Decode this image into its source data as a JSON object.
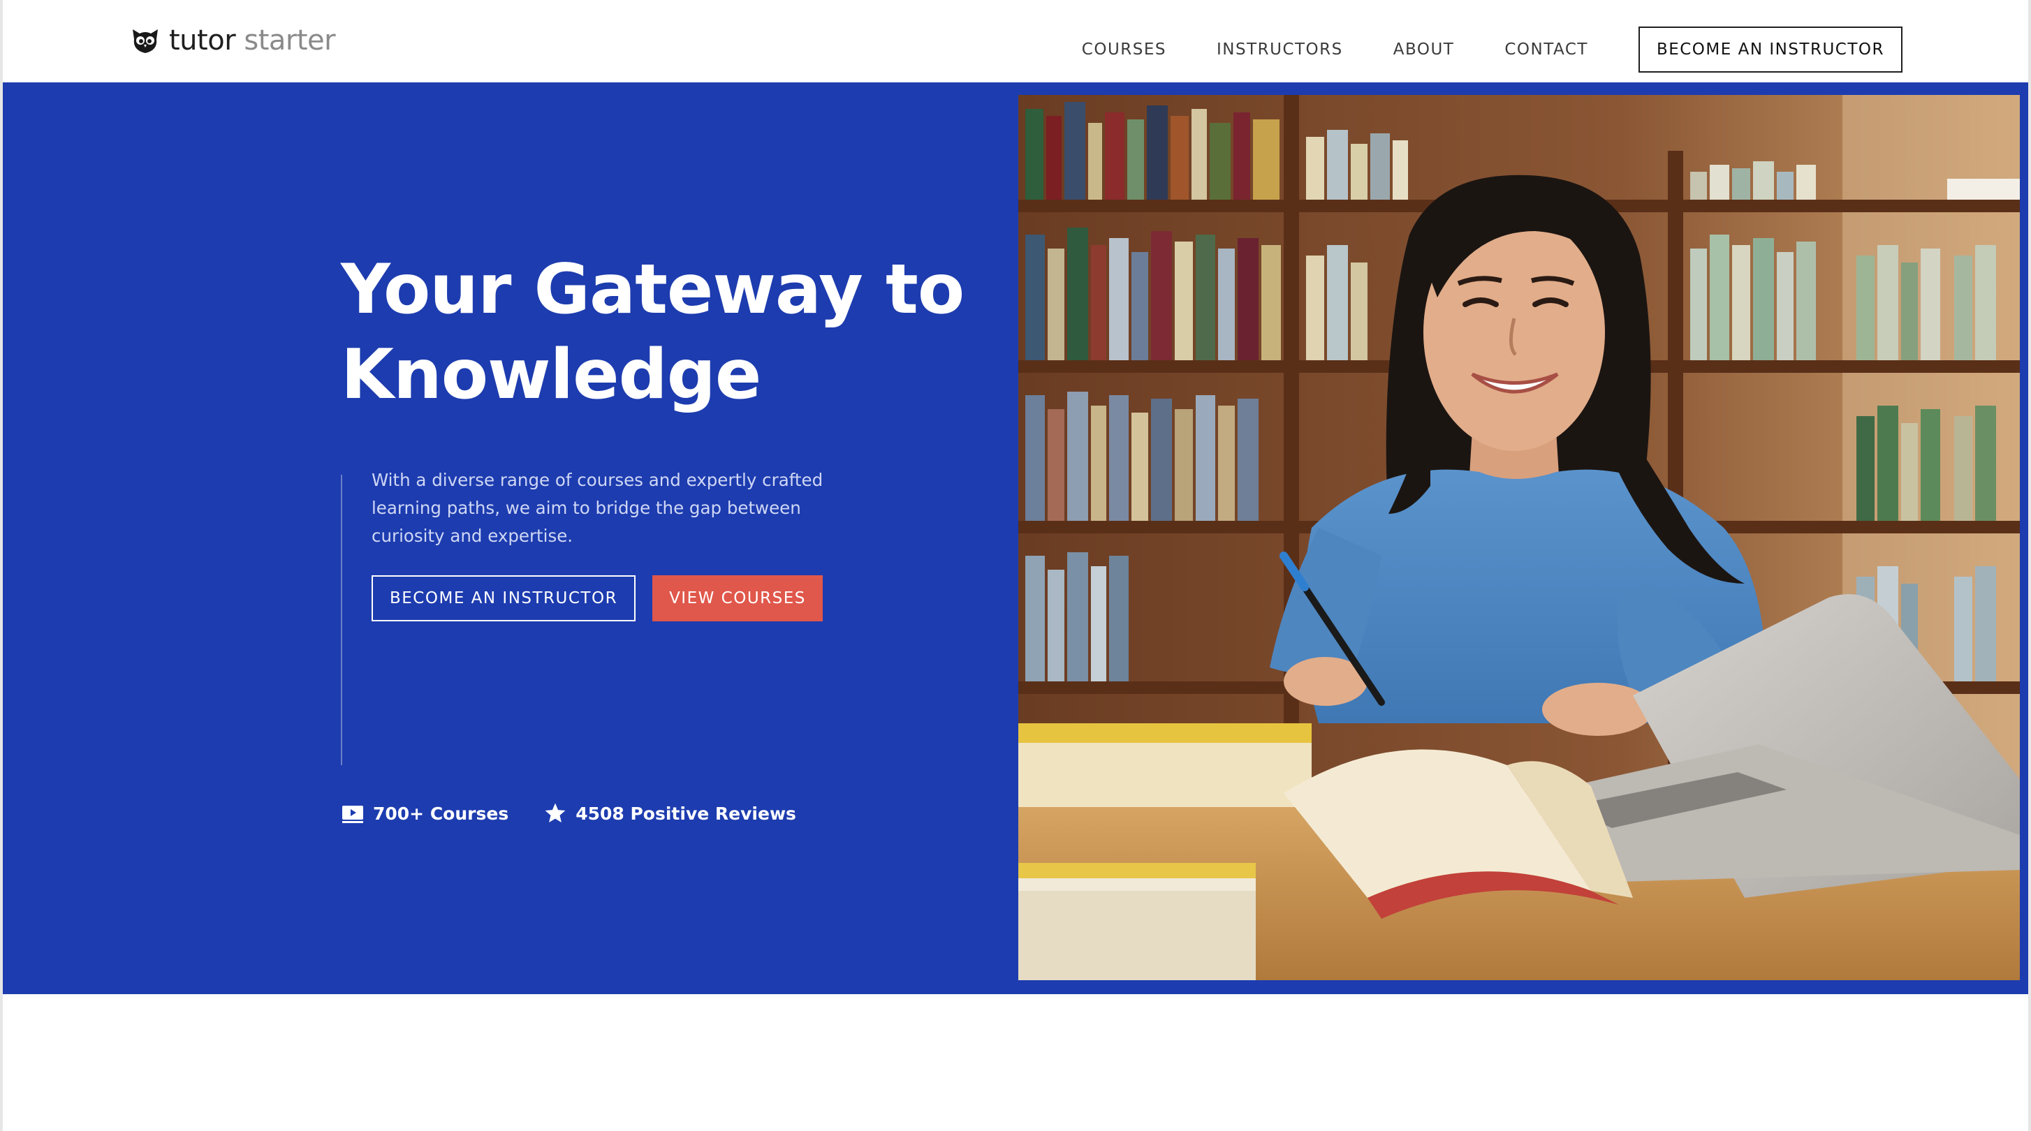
{
  "brand": {
    "name_primary": "tutor",
    "name_secondary": "starter",
    "logo_icon": "owl-icon"
  },
  "nav": {
    "items": [
      {
        "label": "COURSES"
      },
      {
        "label": "INSTRUCTORS"
      },
      {
        "label": "ABOUT"
      },
      {
        "label": "CONTACT"
      }
    ],
    "cta_label": "BECOME AN INSTRUCTOR"
  },
  "hero": {
    "title_line1": "Your Gateway to",
    "title_line2": "Knowledge",
    "description": "With a diverse range of courses and expertly crafted learning paths, we aim to bridge the gap between curiosity and expertise.",
    "primary_button": "BECOME AN INSTRUCTOR",
    "secondary_button": "VIEW COURSES",
    "stats": [
      {
        "icon": "video-icon",
        "label": "700+ Courses"
      },
      {
        "icon": "star-icon",
        "label": "4508 Positive Reviews"
      }
    ],
    "image": {
      "subject": "student-studying-in-library-photo"
    }
  },
  "colors": {
    "hero_background": "#1d3caf",
    "accent_button": "#e0574b",
    "text_dark": "#1f1f1f"
  }
}
